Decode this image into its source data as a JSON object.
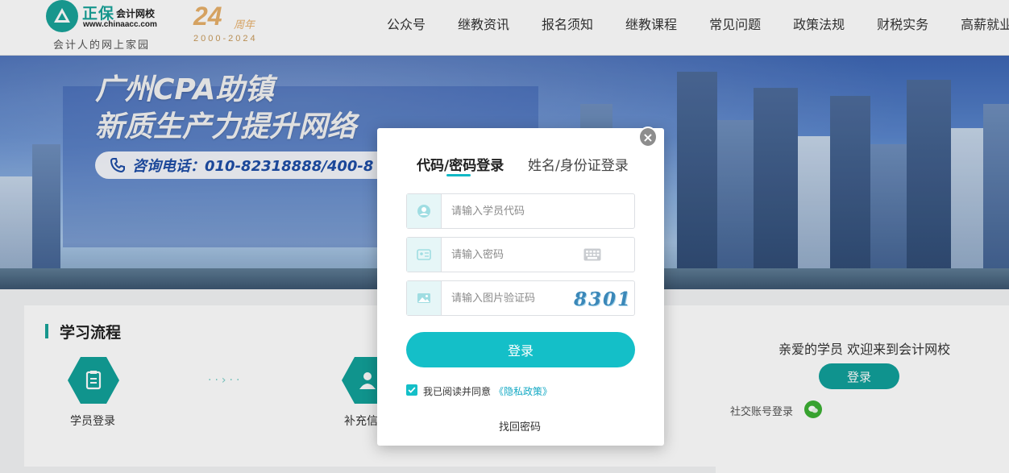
{
  "header": {
    "logo_name": "正保",
    "logo_sub": "会计网校",
    "logo_url": "www.chinaacc.com",
    "slogan": "会计人的网上家园",
    "anniversary_number": "24",
    "anniversary_text": "周年",
    "anniversary_years": "2000-2024",
    "nav": [
      "公众号",
      "继教资讯",
      "报名须知",
      "继教课程",
      "常见问题",
      "政策法规",
      "财税实务",
      "高薪就业"
    ]
  },
  "banner": {
    "title_line1": "广州CPA助镇",
    "title_line2": "新质生产力提升网络",
    "hotline": "咨询电话：010-82318888/400-8"
  },
  "process": {
    "title": "学习流程",
    "steps": [
      "学员登录",
      "补充信"
    ]
  },
  "side": {
    "welcome": "亲爱的学员 欢迎来到会计网校",
    "login_label": "登录",
    "social_label": "社交账号登录"
  },
  "modal": {
    "tabs": [
      "代码/密码登录",
      "姓名/身份证登录"
    ],
    "close_label": "×",
    "student_code_placeholder": "请输入学员代码",
    "password_placeholder": "请输入密码",
    "captcha_placeholder": "请输入图片验证码",
    "captcha_code": "8301",
    "login_label": "登录",
    "agree_text": "我已阅读并同意",
    "privacy_link": "《隐私政策》",
    "forgot_label": "找回密码"
  },
  "colors": {
    "accent": "#14bfc8",
    "brand": "#1aa39a"
  }
}
